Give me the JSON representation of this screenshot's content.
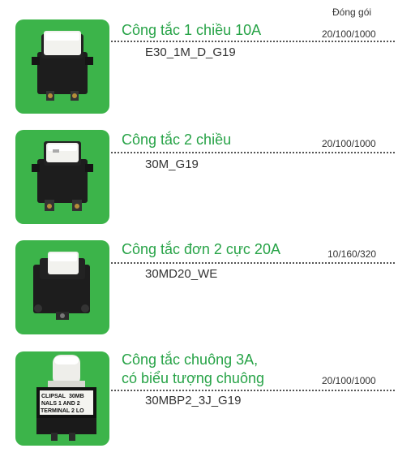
{
  "header": {
    "packaging_label": "Đóng gói"
  },
  "products": [
    {
      "title_line1": "Công tắc 1 chiều 10A",
      "title_line2": "",
      "code": "E30_1M_D_G19",
      "packaging": "20/100/1000",
      "image": "single-switch-module-icon"
    },
    {
      "title_line1": "Công tắc 2 chiều",
      "title_line2": "",
      "code": "30M_G19",
      "packaging": "20/100/1000",
      "image": "two-way-switch-module-icon"
    },
    {
      "title_line1": "Công tắc đơn 2 cực 20A",
      "title_line2": "",
      "code": "30MD20_WE",
      "packaging": "10/160/320",
      "image": "double-pole-switch-module-icon"
    },
    {
      "title_line1": "Công tắc chuông 3A,",
      "title_line2": "có biểu tượng chuông",
      "code": "30MBP2_3J_G19",
      "packaging": "20/100/1000",
      "image": "bell-press-switch-module-icon"
    }
  ],
  "colors": {
    "thumb_bg": "#3cb44a",
    "title": "#27a347",
    "text": "#333333"
  },
  "module_print": {
    "brand": "CLIPSAL",
    "line1": "30MB",
    "line2": "NALS 1 AND 2",
    "line3": "TERMINAL 2 LO"
  }
}
